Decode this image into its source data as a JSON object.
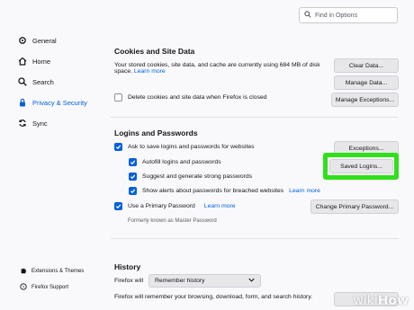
{
  "search": {
    "placeholder": "Find in Options"
  },
  "sidebar": {
    "items": [
      {
        "label": "General",
        "icon": "gear-icon"
      },
      {
        "label": "Home",
        "icon": "home-icon"
      },
      {
        "label": "Search",
        "icon": "search-icon"
      },
      {
        "label": "Privacy & Security",
        "icon": "lock-icon"
      },
      {
        "label": "Sync",
        "icon": "sync-icon"
      }
    ],
    "footer": [
      {
        "label": "Extensions & Themes",
        "icon": "puzzle-icon"
      },
      {
        "label": "Firefox Support",
        "icon": "help-icon"
      }
    ]
  },
  "cookies": {
    "title": "Cookies and Site Data",
    "desc_line1": "Your stored cookies, site data, and cache are currently using 684 MB of disk",
    "desc_line2": "space.",
    "learn_more": "Learn more",
    "delete_on_close": "Delete cookies and site data when Firefox is closed",
    "delete_on_close_checked": false,
    "clear_data": "Clear Data...",
    "manage_data": "Manage Data...",
    "manage_exceptions": "Manage Exceptions..."
  },
  "logins": {
    "title": "Logins and Passwords",
    "ask_to_save": "Ask to save logins and passwords for websites",
    "autofill": "Autofill logins and passwords",
    "suggest": "Suggest and generate strong passwords",
    "breach_alerts": "Show alerts about passwords for breached websites",
    "learn_more": "Learn more",
    "primary_password": "Use a Primary Password",
    "primary_learn_more": "Learn more",
    "formerly": "Formerly known as Master Password",
    "exceptions": "Exceptions...",
    "saved_logins": "Saved Logins...",
    "change_primary": "Change Primary Password..."
  },
  "history": {
    "title": "History",
    "firefox_will": "Firefox will",
    "mode": "Remember history",
    "desc": "Firefox will remember your browsing, download, form, and search history."
  },
  "watermark": {
    "wiki": "wiki",
    "how": "How"
  },
  "colors": {
    "accent": "#0061e0",
    "highlight": "#2fe01a"
  }
}
